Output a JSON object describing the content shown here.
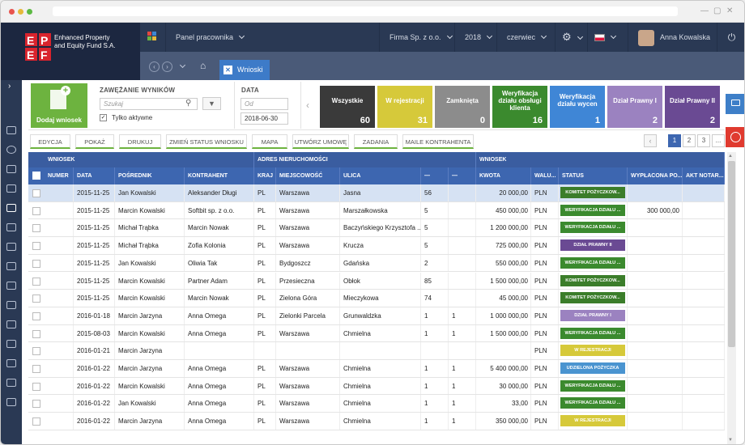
{
  "brand": {
    "name_line1": "Enhanced Property",
    "name_line2": "and Equity Fund S.A.",
    "logo_letters": "EP EF"
  },
  "topbar": {
    "panel": "Panel pracownika",
    "company": "Firma Sp. z o.o.",
    "year": "2018",
    "month": "czerwiec",
    "user": "Anna Kowalska"
  },
  "subbar": {
    "tab": "Wnioski"
  },
  "filter": {
    "add_label": "Dodaj wniosek",
    "narrow_title": "ZAWĘŻANIE WYNIKÓW",
    "search_placeholder": "Szukaj",
    "active_only": "Tylko aktywne",
    "date_title": "DATA",
    "date_from_placeholder": "Od",
    "date_to": "2018-06-30"
  },
  "stats": [
    {
      "label": "Wszystkie",
      "count": "60",
      "color": "#3a3a3a"
    },
    {
      "label": "W rejestracji",
      "count": "31",
      "color": "#d6c93a"
    },
    {
      "label": "Zamknięta",
      "count": "0",
      "color": "#8c8c8c"
    },
    {
      "label": "Weryfikacja działu obsługi klienta",
      "count": "16",
      "color": "#3b8a2e"
    },
    {
      "label": "Weryfikacja działu wycen",
      "count": "1",
      "color": "#3f86d6"
    },
    {
      "label": "Dział Prawny I",
      "count": "2",
      "color": "#9b82c0"
    },
    {
      "label": "Dział Prawny II",
      "count": "2",
      "color": "#6a4a93"
    }
  ],
  "actions": [
    "EDYCJA",
    "POKAŻ",
    "DRUKUJ",
    "ZMIEŃ STATUS WNIOSKU",
    "MAPA",
    "UTWÓRZ UMOWĘ",
    "ZADANIA",
    "MAILE KONTRAHENTA"
  ],
  "pagination": [
    "1",
    "2",
    "3",
    "..."
  ],
  "table": {
    "groups": [
      "WNIOSEK",
      "ADRES NIERUCHOMOŚCI",
      "WNIOSEK"
    ],
    "columns": [
      "NUMER",
      "DATA",
      "POŚREDNIK",
      "KONTRAHENT",
      "KRAJ",
      "MIEJSCOWOŚĆ",
      "ULICA",
      "—",
      "—",
      "KWOTA",
      "WALU...",
      "STATUS",
      "WYPŁACONA PO...",
      "AKT NOTAR..."
    ],
    "rows": [
      [
        "",
        "2015-11-25",
        "Jan Kowalski",
        "Aleksander Długi",
        "PL",
        "Warszawa",
        "Jasna",
        "56",
        "",
        "20 000,00",
        "PLN",
        "KOMITET POŻYCZKOW...",
        ""
      ],
      [
        "",
        "2015-11-25",
        "Marcin Kowalski",
        "Softbit sp. z o.o.",
        "PL",
        "Warszawa",
        "Marszałkowska",
        "5",
        "",
        "450 000,00",
        "PLN",
        "WERYFIKACJA DZIAŁU ...",
        "300 000,00"
      ],
      [
        "",
        "2015-11-25",
        "Michał Trąbka",
        "Marcin Nowak",
        "PL",
        "Warszawa",
        "Baczyńskiego Krzysztofa ...",
        "5",
        "",
        "1 200 000,00",
        "PLN",
        "WERYFIKACJA DZIAŁU ...",
        ""
      ],
      [
        "",
        "2015-11-25",
        "Michał Trąbka",
        "Zofia Kolonia",
        "PL",
        "Warszawa",
        "Krucza",
        "5",
        "",
        "725 000,00",
        "PLN",
        "DZIAŁ PRAWNY II",
        ""
      ],
      [
        "",
        "2015-11-25",
        "Jan Kowalski",
        "Oliwia Tak",
        "PL",
        "Bydgoszcz",
        "Gdańska",
        "2",
        "",
        "550 000,00",
        "PLN",
        "WERYFIKACJA DZIAŁU ...",
        ""
      ],
      [
        "",
        "2015-11-25",
        "Marcin Kowalski",
        "Partner Adam",
        "PL",
        "Przesieczna",
        "Obłok",
        "85",
        "",
        "1 500 000,00",
        "PLN",
        "KOMITET POŻYCZKOW...",
        ""
      ],
      [
        "",
        "2015-11-25",
        "Marcin Kowalski",
        "Marcin Nowak",
        "PL",
        "Zielona Góra",
        "Mieczykowa",
        "74",
        "",
        "45 000,00",
        "PLN",
        "KOMITET POŻYCZKOW...",
        ""
      ],
      [
        "",
        "2016-01-18",
        "Marcin Jarzyna",
        "Anna Omega",
        "PL",
        "Zielonki Parcela",
        "Grunwaldzka",
        "1",
        "1",
        "1 000 000,00",
        "PLN",
        "DZIAŁ PRAWNY I",
        ""
      ],
      [
        "",
        "2015-08-03",
        "Marcin Kowalski",
        "Anna Omega",
        "PL",
        "Warszawa",
        "Chmielna",
        "1",
        "1",
        "1 500 000,00",
        "PLN",
        "WERYFIKACJA DZIAŁU ...",
        ""
      ],
      [
        "",
        "2016-01-21",
        "Marcin Jarzyna",
        "",
        "",
        "",
        "",
        "",
        "",
        "",
        "PLN",
        "W REJESTRACJI",
        ""
      ],
      [
        "",
        "2016-01-22",
        "Marcin Jarzyna",
        "Anna Omega",
        "PL",
        "Warszawa",
        "Chmielna",
        "1",
        "1",
        "5 400 000,00",
        "PLN",
        "UDZIELONA POŻYCZKA",
        ""
      ],
      [
        "",
        "2016-01-22",
        "Marcin Kowalski",
        "Anna Omega",
        "PL",
        "Warszawa",
        "Chmielna",
        "1",
        "1",
        "30 000,00",
        "PLN",
        "WERYFIKACJA DZIAŁU ...",
        ""
      ],
      [
        "",
        "2016-01-22",
        "Jan Kowalski",
        "Anna Omega",
        "PL",
        "Warszawa",
        "Chmielna",
        "1",
        "1",
        "33,00",
        "PLN",
        "WERYFIKACJA DZIAŁU ...",
        ""
      ],
      [
        "",
        "2016-01-22",
        "Marcin Jarzyna",
        "Anna Omega",
        "PL",
        "Warszawa",
        "Chmielna",
        "1",
        "1",
        "350 000,00",
        "PLN",
        "W REJESTRACJI",
        ""
      ]
    ],
    "status_colors": {
      "KOMITET POŻYCZKOW...": "#3b7d2a",
      "WERYFIKACJA DZIAŁU ...": "#3b8a2e",
      "DZIAŁ PRAWNY II": "#6a4a93",
      "DZIAŁ PRAWNY I": "#9b82c0",
      "W REJESTRACJI": "#d6c93a",
      "UDZIELONA POŻYCZKA": "#4a94d0"
    }
  }
}
